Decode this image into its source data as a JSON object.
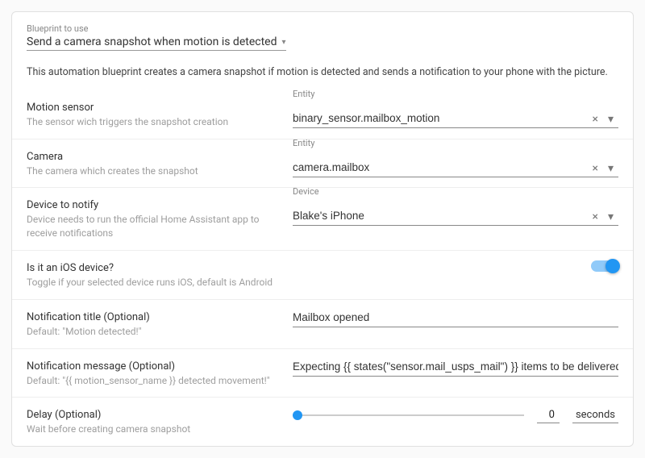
{
  "blueprint": {
    "label": "Blueprint to use",
    "value": "Send a camera snapshot when motion is detected",
    "description": "This automation blueprint creates a camera snapshot if motion is detected and sends a notification to your phone with the picture."
  },
  "fields": {
    "motion_sensor": {
      "title": "Motion sensor",
      "sub": "The sensor wich triggers the snapshot creation",
      "mini_label": "Entity",
      "value": "binary_sensor.mailbox_motion"
    },
    "camera": {
      "title": "Camera",
      "sub": "The camera which creates the snapshot",
      "mini_label": "Entity",
      "value": "camera.mailbox"
    },
    "device": {
      "title": "Device to notify",
      "sub": "Device needs to run the official Home Assistant app to receive notifications",
      "mini_label": "Device",
      "value": "Blake's iPhone"
    },
    "ios": {
      "title": "Is it an iOS device?",
      "sub": "Toggle if your selected device runs iOS, default is Android",
      "on": true
    },
    "notif_title": {
      "title": "Notification title (Optional)",
      "sub": "Default: \"Motion detected!\"",
      "value": "Mailbox opened"
    },
    "notif_msg": {
      "title": "Notification message (Optional)",
      "sub": "Default: \"{{ motion_sensor_name }} detected movement!\"",
      "value": "Expecting {{ states(\"sensor.mail_usps_mail\") }} items to be delivered."
    },
    "delay": {
      "title": "Delay (Optional)",
      "sub": "Wait before creating camera snapshot",
      "value": "0",
      "unit": "seconds"
    }
  },
  "icons": {
    "clear": "×",
    "dropdown": "▾",
    "arrow": "▾"
  }
}
